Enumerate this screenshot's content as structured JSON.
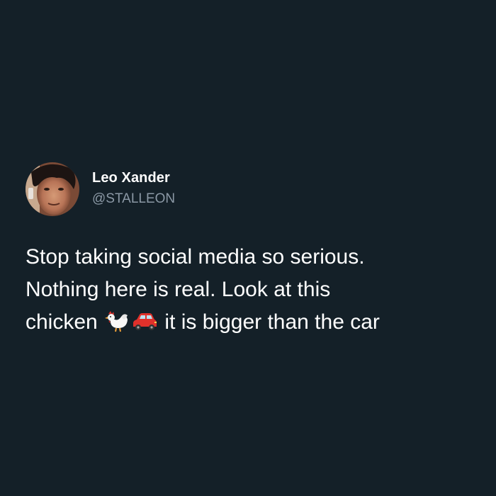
{
  "tweet": {
    "author": {
      "display_name": "Leo Xander",
      "handle": "@STALLEON"
    },
    "text": {
      "line1": "Stop taking social media so serious.",
      "line2": "Nothing here is real. Look at this",
      "line3_before": "chicken ",
      "line3_after": " it is bigger than the car"
    },
    "emojis": [
      "rooster-emoji",
      "car-emoji"
    ]
  },
  "colors": {
    "background": "#142028",
    "text": "#ffffff",
    "handle": "#8b98a5"
  }
}
